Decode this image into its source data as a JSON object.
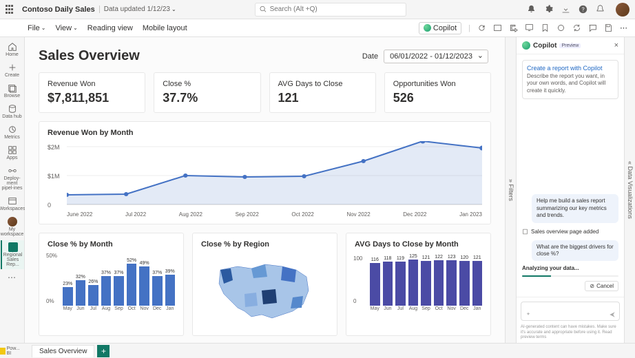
{
  "topbar": {
    "workspace": "Contoso Daily Sales",
    "data_updated": "Data updated 1/12/23",
    "search_placeholder": "Search (Alt +Q)"
  },
  "ribbon": {
    "file": "File",
    "view": "View",
    "reading": "Reading view",
    "mobile": "Mobile layout",
    "copilot": "Copilot"
  },
  "leftnav": {
    "items": [
      "Home",
      "Create",
      "Browse",
      "Data hub",
      "Metrics",
      "Apps",
      "Deploy-ment pipel-ines",
      "Workspaces",
      "My workspace",
      "Regional Sales Rep..."
    ]
  },
  "page": {
    "title": "Sales Overview",
    "date_label": "Date",
    "date_value": "06/01/2022 - 01/12/2023"
  },
  "kpis": [
    {
      "label": "Revenue Won",
      "value": "$7,811,851"
    },
    {
      "label": "Close %",
      "value": "37.7%"
    },
    {
      "label": "AVG Days to Close",
      "value": "121"
    },
    {
      "label": "Opportunities Won",
      "value": "526"
    }
  ],
  "chart_data": [
    {
      "type": "line",
      "title": "Revenue Won by Month",
      "categories": [
        "June 2022",
        "Jul 2022",
        "Aug 2022",
        "Sep 2022",
        "Oct 2022",
        "Nov 2022",
        "Dec 2022",
        "Jan 2023"
      ],
      "values": [
        300000,
        320000,
        900000,
        850000,
        870000,
        1350000,
        2000000,
        1800000
      ],
      "ylabel": "",
      "ylim": [
        0,
        2000000
      ],
      "yticks": [
        "$1M",
        "$2M"
      ]
    },
    {
      "type": "bar",
      "title": "Close % by Month",
      "categories": [
        "May",
        "Jun",
        "Jul",
        "Aug",
        "Sep",
        "Oct",
        "Nov",
        "Dec",
        "Jan"
      ],
      "values": [
        23,
        32,
        26,
        37,
        37,
        52,
        49,
        37,
        39
      ],
      "ylabel": "",
      "yticks": [
        "0%",
        "50%"
      ],
      "ylim": [
        0,
        60
      ],
      "value_suffix": "%"
    },
    {
      "type": "map",
      "title": "Close % by Region",
      "region": "USA"
    },
    {
      "type": "bar",
      "title": "AVG Days to Close by Month",
      "categories": [
        "May",
        "Jun",
        "Jul",
        "Aug",
        "Sep",
        "Oct",
        "Nov",
        "Dec",
        "Jan"
      ],
      "values": [
        116,
        118,
        119,
        125,
        121,
        122,
        123,
        120,
        121
      ],
      "yticks": [
        "0",
        "100"
      ],
      "ylim": [
        0,
        130
      ]
    }
  ],
  "copilot": {
    "title": "Copilot",
    "badge": "Preview",
    "card_head": "Create a report with Copilot",
    "card_desc": "Describe the report you want, in your own words, and Copilot will create it quickly.",
    "msg1": "Help me build a sales report summarizing our key metrics and trends.",
    "added": "Sales overview page added",
    "msg2": "What are the biggest drivers for close %?",
    "analyzing": "Analyzing your data...",
    "cancel": "Cancel",
    "footer": "AI-generated content can have mistakes. Make sure it's accurate and appropriate before using it. Read preview terms"
  },
  "rails": {
    "filters": "Filters",
    "viz": "Data Visualizations"
  },
  "tabs": {
    "active": "Sales Overview"
  },
  "bottom": {
    "label": "Pow... BI"
  }
}
